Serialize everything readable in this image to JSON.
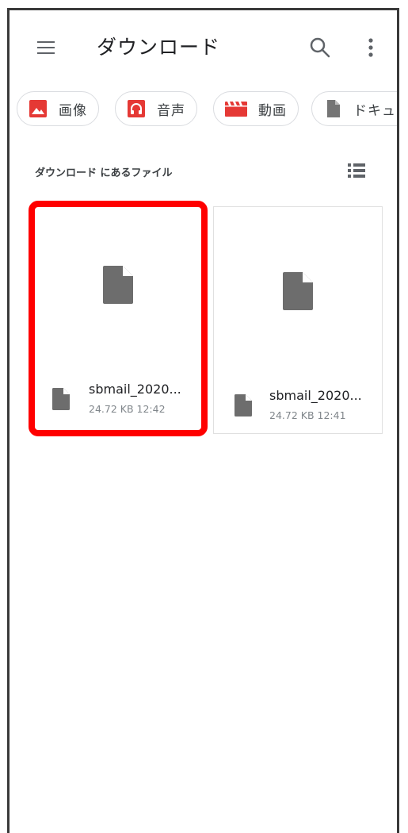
{
  "app_bar": {
    "title": "ダウンロード",
    "menu_icon": "menu-icon",
    "search_icon": "search-icon",
    "more_icon": "more-vert-icon"
  },
  "chips": [
    {
      "label": "画像",
      "icon": "image-icon",
      "color": "#e53935"
    },
    {
      "label": "音声",
      "icon": "headphones-icon",
      "color": "#e53935"
    },
    {
      "label": "動画",
      "icon": "movie-icon",
      "color": "#e53935"
    },
    {
      "label": "ドキュメ",
      "icon": "document-icon",
      "color": "#757575"
    }
  ],
  "section": {
    "label": "ダウンロード にあるファイル",
    "view_toggle_icon": "list-view-icon"
  },
  "files": [
    {
      "name": "sbmail_2020...",
      "meta": "24.72 KB 12:42",
      "icon": "file-icon",
      "highlighted": true
    },
    {
      "name": "sbmail_2020...",
      "meta": "24.72 KB 12:41",
      "icon": "file-icon",
      "highlighted": false
    }
  ],
  "colors": {
    "highlight": "#ff0000",
    "icon_gray": "#757575",
    "chip_red": "#e53935"
  }
}
